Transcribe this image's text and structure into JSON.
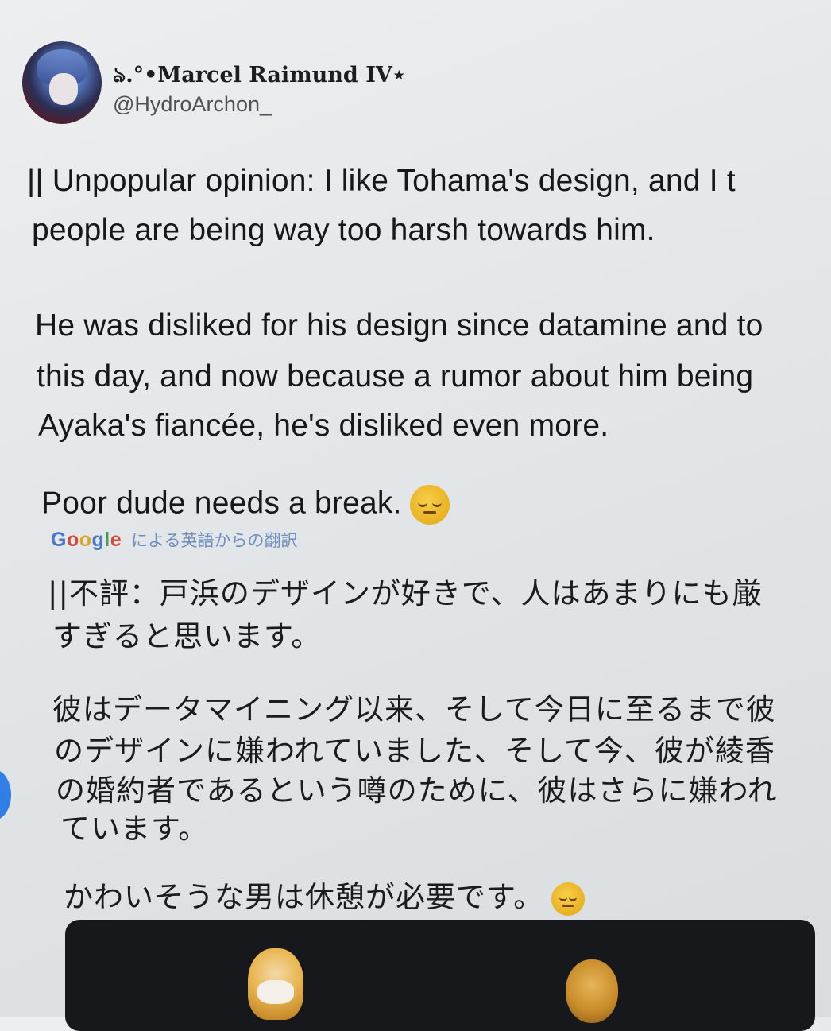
{
  "tweet": {
    "author": {
      "display_name": "ঌ.°•Marcel Raimund IV⋆",
      "handle": "@HydroArchon_"
    },
    "original": {
      "line1": "|| Unpopular opinion: I like Tohama's design, and I t",
      "line2": "people are being way too harsh towards him.",
      "line3": "He was disliked for his design since datamine and to",
      "line4": "this day, and now because a rumor about him being",
      "line5": "Ayaka's fiancée, he's disliked even more.",
      "line6": "Poor dude needs a break."
    },
    "translation_label": {
      "google": [
        "G",
        "o",
        "o",
        "g",
        "l",
        "e"
      ],
      "text": "による英語からの翻訳"
    },
    "translated": {
      "line1": "||不評：戸浜のデザインが好きで、人はあまりにも厳",
      "line2": "すぎると思います。",
      "line3": "彼はデータマイニング以来、そして今日に至るまで彼",
      "line4": "のデザインに嫌われていました、そして今、彼が綾香",
      "line5": "の婚約者であるという噂のために、彼はさらに嫌われ",
      "line6": "ています。",
      "line7": "かわいそうな男は休憩が必要です。"
    },
    "emoji": "pensive-face"
  }
}
